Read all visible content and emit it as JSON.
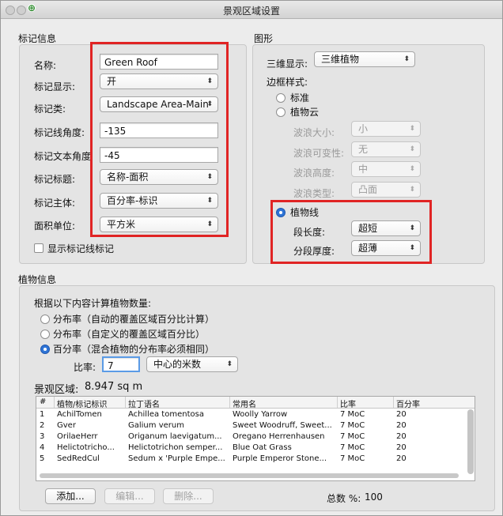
{
  "window": {
    "title": "景观区域设置"
  },
  "marker_info": {
    "section_title": "标记信息",
    "name_label": "名称:",
    "name_value": "Green Roof",
    "marker_display_label": "标记显示:",
    "marker_display_value": "开",
    "marker_class_label": "标记类:",
    "marker_class_value": "Landscape Area-Main",
    "line_angle_label": "标记线角度:",
    "line_angle_value": "-135",
    "text_angle_label": "标记文本角度",
    "text_angle_value": "-45",
    "title_label": "标记标题:",
    "title_value": "名称-面积",
    "body_label": "标记主体:",
    "body_value": "百分率-标识",
    "area_unit_label": "面积单位:",
    "area_unit_value": "平方米",
    "show_leader_label": "显示标记线标记"
  },
  "graphics": {
    "section_title": "图形",
    "display_3d_label": "三维显示:",
    "display_3d_value": "三维植物",
    "border_style_label": "边框样式:",
    "options": {
      "standard": "标准",
      "plant_cloud": "植物云",
      "plant_line": "植物线"
    },
    "wave_size_label": "波浪大小:",
    "wave_size_value": "小",
    "wave_variability_label": "波浪可变性:",
    "wave_variability_value": "无",
    "wave_height_label": "波浪高度:",
    "wave_height_value": "中",
    "wave_type_label": "波浪类型:",
    "wave_type_value": "凸面",
    "segment_length_label": "段长度:",
    "segment_length_value": "超短",
    "segment_thickness_label": "分段厚度:",
    "segment_thickness_value": "超薄"
  },
  "plant_info": {
    "section_title": "植物信息",
    "calc_label": "根据以下内容计算植物数量:",
    "options": {
      "auto": "分布率（自动的覆盖区域百分比计算）",
      "custom": "分布率（自定义的覆盖区域百分比）",
      "percent": "百分率（混合植物的分布率必须相同）"
    },
    "ratio_label": "比率:",
    "ratio_value": "7",
    "ratio_unit": "中心的米数",
    "area_label": "景观区域:",
    "area_value": "8.947 sq m",
    "table": {
      "headers": [
        "#",
        "植物/标记标识",
        "拉丁语名",
        "常用名",
        "比率",
        "百分率"
      ],
      "rows": [
        [
          "1",
          "AchilTomen",
          "Achillea tomentosa",
          "Woolly Yarrow",
          "7 MoC",
          "20"
        ],
        [
          "2",
          "Gver",
          "Galium verum",
          "Sweet Woodruff, Sweet...",
          "7 MoC",
          "20"
        ],
        [
          "3",
          "OrilaeHerr",
          "Origanum laevigatum...",
          "Oregano Herrenhausen",
          "7 MoC",
          "20"
        ],
        [
          "4",
          "Helictotricho...",
          "Helictotrichon semper...",
          "Blue Oat Grass",
          "7 MoC",
          "20"
        ],
        [
          "5",
          "SedRedCul",
          "Sedum x 'Purple Empe...",
          "Purple Emperor Stone...",
          "7 MoC",
          "20"
        ]
      ]
    },
    "add_button": "添加...",
    "edit_button": "编辑...",
    "delete_button": "删除...",
    "total_label": "总数 %:",
    "total_value": "100"
  },
  "colors": {
    "highlight_box": "#e02424",
    "radio_selected": "#2e74d6"
  }
}
